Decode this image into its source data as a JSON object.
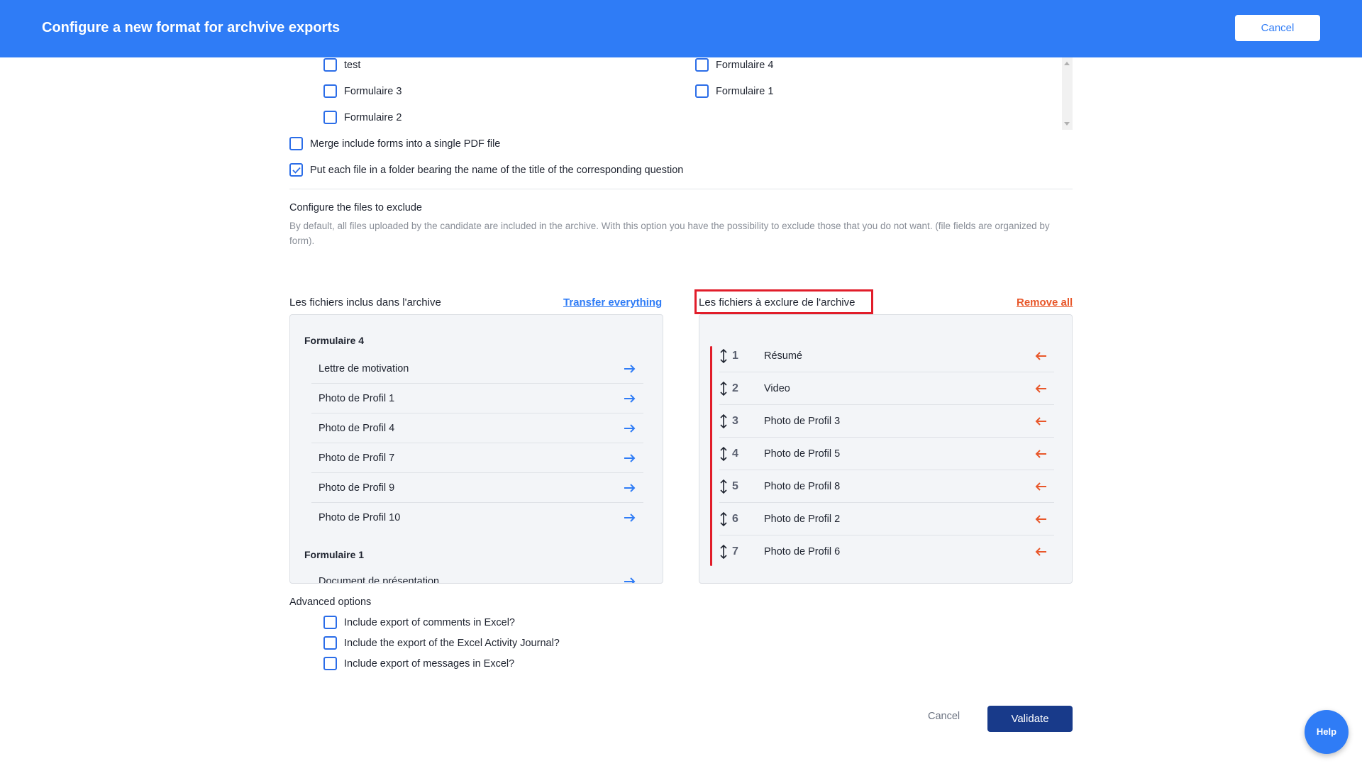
{
  "header": {
    "title": "Configure a new format for archvive exports",
    "cancel_label": "Cancel"
  },
  "forms": {
    "col1": [
      {
        "label": "test",
        "checked": false
      },
      {
        "label": "Formulaire 3",
        "checked": false
      },
      {
        "label": "Formulaire 2",
        "checked": false
      }
    ],
    "col2": [
      {
        "label": "Formulaire 4",
        "checked": false
      },
      {
        "label": "Formulaire 1",
        "checked": false
      }
    ]
  },
  "options": {
    "merge_label": "Merge include forms into a single PDF file",
    "merge_checked": false,
    "folder_label": "Put each file in a folder bearing the name of the title of the corresponding question",
    "folder_checked": true
  },
  "exclude_section": {
    "title": "Configure the files to exclude",
    "description": "By default, all files uploaded by the candidate are included in the archive. With this option you have the possibility to exclude those that you do not want. (file fields are organized by form)."
  },
  "included_panel": {
    "title": "Les fichiers inclus dans l'archive",
    "transfer_label": "Transfer everything",
    "groups": [
      {
        "title": "Formulaire 4",
        "files": [
          "Lettre de motivation",
          "Photo de Profil 1",
          "Photo de Profil 4",
          "Photo de Profil 7",
          "Photo de Profil 9",
          "Photo de Profil 10"
        ]
      },
      {
        "title": "Formulaire 1",
        "files": [
          "Document de présentation"
        ]
      }
    ]
  },
  "excluded_panel": {
    "title": "Les fichiers à exclure de l'archive",
    "remove_label": "Remove all",
    "files": [
      {
        "num": "1",
        "label": "Résumé"
      },
      {
        "num": "2",
        "label": "Video"
      },
      {
        "num": "3",
        "label": "Photo de Profil 3"
      },
      {
        "num": "4",
        "label": "Photo de Profil 5"
      },
      {
        "num": "5",
        "label": "Photo de Profil 8"
      },
      {
        "num": "6",
        "label": "Photo de Profil 2"
      },
      {
        "num": "7",
        "label": "Photo de Profil 6"
      }
    ]
  },
  "advanced": {
    "title": "Advanced options",
    "items": [
      {
        "label": "Include export of comments in Excel?",
        "checked": false
      },
      {
        "label": "Include the export of the Excel Activity Journal?",
        "checked": false
      },
      {
        "label": "Include export of messages in Excel?",
        "checked": false
      }
    ]
  },
  "footer": {
    "cancel_label": "Cancel",
    "validate_label": "Validate",
    "help_label": "Help"
  },
  "colors": {
    "header": "#2f7cf6",
    "validate": "#183a8a",
    "accent_red": "#e8572a",
    "highlight": "#e11d2a"
  }
}
